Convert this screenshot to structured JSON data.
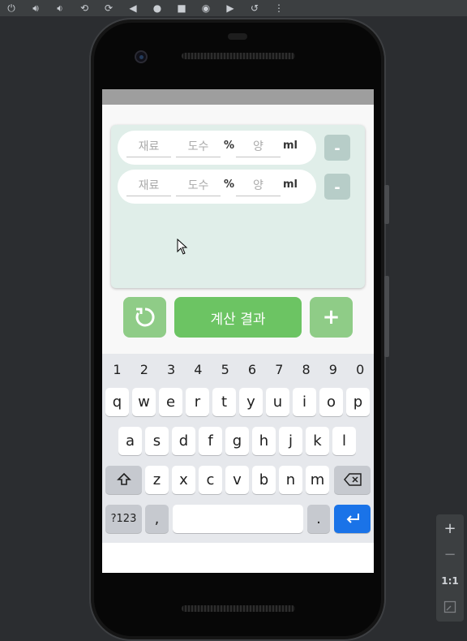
{
  "emulator": {
    "toolbar_icons": [
      "power-icon",
      "volume-up-icon",
      "volume-down-icon",
      "rotate-left-icon",
      "rotate-right-icon",
      "back-icon",
      "home-icon",
      "overview-icon",
      "screenshot-icon",
      "screenrecord-icon",
      "snapshot-icon",
      "more-icon"
    ],
    "zoom": {
      "plus": "+",
      "minus": "−",
      "one_to_one": "1:1"
    }
  },
  "app": {
    "rows": [
      {
        "ingredient_placeholder": "재료",
        "abv_placeholder": "도수",
        "percent_label": "%",
        "amount_placeholder": "양",
        "unit_label": "ml",
        "remove_label": "-"
      },
      {
        "ingredient_placeholder": "재료",
        "abv_placeholder": "도수",
        "percent_label": "%",
        "amount_placeholder": "양",
        "unit_label": "ml",
        "remove_label": "-"
      }
    ],
    "calc_label": "계산 결과",
    "add_label": "+",
    "colors": {
      "card_bg": "#e0eee9",
      "calc_green": "#6cc463",
      "light_green": "#8fcc87",
      "minus_bg": "#b7cdc8"
    }
  },
  "keyboard": {
    "numbers": [
      "1",
      "2",
      "3",
      "4",
      "5",
      "6",
      "7",
      "8",
      "9",
      "0"
    ],
    "row1": [
      "q",
      "w",
      "e",
      "r",
      "t",
      "y",
      "u",
      "i",
      "o",
      "p"
    ],
    "row2": [
      "a",
      "s",
      "d",
      "f",
      "g",
      "h",
      "j",
      "k",
      "l"
    ],
    "row3": [
      "z",
      "x",
      "c",
      "v",
      "b",
      "n",
      "m"
    ],
    "symbols_label": "?123",
    "comma_label": ",",
    "period_label": ".",
    "shift_icon": "shift-icon",
    "backspace_icon": "backspace-icon",
    "enter_icon": "enter-icon",
    "colors": {
      "enter": "#1a73e8"
    }
  }
}
